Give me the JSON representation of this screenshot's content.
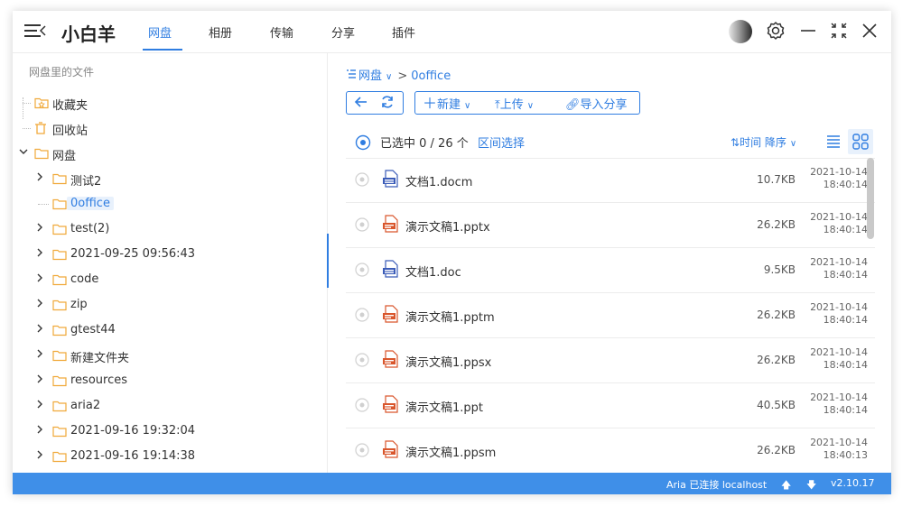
{
  "app": {
    "title": "小白羊"
  },
  "nav": {
    "tabs": [
      {
        "label": "网盘",
        "active": true
      },
      {
        "label": "相册",
        "active": false
      },
      {
        "label": "传输",
        "active": false
      },
      {
        "label": "分享",
        "active": false
      },
      {
        "label": "插件",
        "active": false
      }
    ]
  },
  "window_controls": {
    "icons": [
      "avatar",
      "gear-icon",
      "minimize-icon",
      "fullscreen-icon",
      "close-icon"
    ]
  },
  "sidebar": {
    "root_label": "网盘里的文件",
    "items": [
      {
        "label": "收藏夹",
        "icon": "star-folder-icon",
        "level": 0,
        "caret": false
      },
      {
        "label": "回收站",
        "icon": "trash-icon",
        "level": 0,
        "caret": false
      },
      {
        "label": "网盘",
        "icon": "folder-icon",
        "level": 0,
        "caret": "down"
      },
      {
        "label": "测试2",
        "icon": "folder-icon",
        "level": 1,
        "caret": "right"
      },
      {
        "label": "0office",
        "icon": "folder-icon",
        "level": 1,
        "caret": false,
        "selected": true
      },
      {
        "label": "test(2)",
        "icon": "folder-icon",
        "level": 1,
        "caret": "right"
      },
      {
        "label": "2021-09-25 09:56:43",
        "icon": "folder-icon",
        "level": 1,
        "caret": "right"
      },
      {
        "label": "code",
        "icon": "folder-icon",
        "level": 1,
        "caret": "right"
      },
      {
        "label": "zip",
        "icon": "folder-icon",
        "level": 1,
        "caret": "right"
      },
      {
        "label": "gtest44",
        "icon": "folder-icon",
        "level": 1,
        "caret": "right"
      },
      {
        "label": "新建文件夹",
        "icon": "folder-icon",
        "level": 1,
        "caret": "right"
      },
      {
        "label": "resources",
        "icon": "folder-icon",
        "level": 1,
        "caret": "right"
      },
      {
        "label": "aria2",
        "icon": "folder-icon",
        "level": 1,
        "caret": "right"
      },
      {
        "label": "2021-09-16 19:32:04",
        "icon": "folder-icon",
        "level": 1,
        "caret": "right"
      },
      {
        "label": "2021-09-16 19:14:38",
        "icon": "folder-icon",
        "level": 1,
        "caret": "right"
      }
    ]
  },
  "breadcrumb": {
    "root": "网盘",
    "current": "0office"
  },
  "toolbar": {
    "new_label": "新建",
    "upload_label": "上传",
    "import_label": "导入分享"
  },
  "list_header": {
    "selected_text": "已选中 0 / 26 个",
    "range_select": "区间选择",
    "sort_label": "时间 降序"
  },
  "files": [
    {
      "name": "文档1.docm",
      "type": "doc",
      "size": "10.7KB",
      "date": "2021-10-14",
      "time": "18:40:14"
    },
    {
      "name": "演示文稿1.pptx",
      "type": "ppt",
      "size": "26.2KB",
      "date": "2021-10-14",
      "time": "18:40:14"
    },
    {
      "name": "文档1.doc",
      "type": "doc",
      "size": "9.5KB",
      "date": "2021-10-14",
      "time": "18:40:14"
    },
    {
      "name": "演示文稿1.pptm",
      "type": "ppt",
      "size": "26.2KB",
      "date": "2021-10-14",
      "time": "18:40:14"
    },
    {
      "name": "演示文稿1.ppsx",
      "type": "ppt",
      "size": "26.2KB",
      "date": "2021-10-14",
      "time": "18:40:14"
    },
    {
      "name": "演示文稿1.ppt",
      "type": "ppt",
      "size": "40.5KB",
      "date": "2021-10-14",
      "time": "18:40:14"
    },
    {
      "name": "演示文稿1.ppsm",
      "type": "ppt",
      "size": "26.2KB",
      "date": "2021-10-14",
      "time": "18:40:13"
    }
  ],
  "status": {
    "aria": "Aria 已连接 localhost",
    "version": "v2.10.17"
  },
  "colors": {
    "accent": "#2f7de1",
    "statusbar": "#3f8fe8",
    "folder": "#f0a93a",
    "doc_icon": "#3b5cb8",
    "ppt_icon": "#d9562c"
  }
}
